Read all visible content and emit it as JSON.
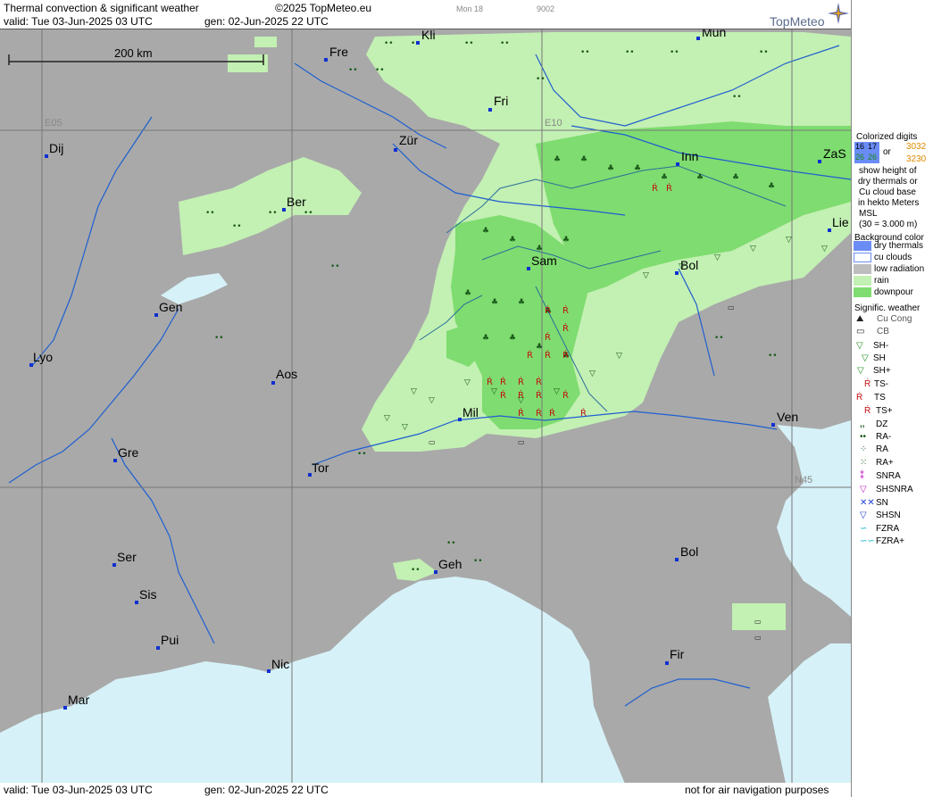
{
  "header": {
    "title": "Thermal convection & significant weather",
    "copyright": "©2025 TopMeteo.eu",
    "valid": "valid:  Tue  03-Jun-2025  03 UTC",
    "gen": "gen:  02-Jun-2025 22 UTC",
    "run": "Mon 18",
    "code": "9002",
    "brand": "TopMeteo"
  },
  "footer": {
    "valid": "valid:  Tue  03-Jun-2025  03 UTC",
    "gen": "gen:  02-Jun-2025 22 UTC",
    "disclaimer": "not for air navigation purposes"
  },
  "map": {
    "scale_label": "200 km",
    "grid_labels": [
      "E05",
      "E10",
      "N45"
    ],
    "cities": [
      "Kli",
      "Mün",
      "Fre",
      "Fri",
      "Dij",
      "Zür",
      "Inn",
      "ZaS",
      "Ber",
      "Lie",
      "Sam",
      "Bol",
      "Gen",
      "Lyo",
      "Aos",
      "Mil",
      "Ven",
      "Gre",
      "Tor",
      "Geh",
      "Ser",
      "Bol",
      "Sis",
      "Pui",
      "Nic",
      "Fir",
      "Mar"
    ],
    "colors": {
      "land": "#a9a9a9",
      "sea": "#d6f2f8",
      "rain": "#c3f0b3",
      "downpour": "#7fdc70",
      "rivers": "#1e5fd0"
    }
  },
  "legend": {
    "colorized_title": [
      "Colorized digits",
      "or",
      "show height of",
      "dry thermals or",
      "Cu cloud base",
      "in hekto Meters",
      "MSL",
      "(30 = 3.000 m)"
    ],
    "sample_cells": [
      "16",
      "17",
      "26",
      "26"
    ],
    "sample_digits": [
      "30",
      "32",
      "32",
      "30"
    ],
    "bg_title": "Background color",
    "bg_items": [
      {
        "label": "dry thermals",
        "color": "#6b8cf5"
      },
      {
        "label": "cu clouds",
        "color": "#ffffff"
      },
      {
        "label": "low radiation",
        "color": "#bdbdbd"
      },
      {
        "label": "rain",
        "color": "#c3f0b3"
      },
      {
        "label": "downpour",
        "color": "#7fdc70"
      }
    ],
    "wx_title": "Signific. weather",
    "wx_items": [
      "Cu Cong",
      "CB",
      "SH-",
      "SH",
      "SH+",
      "TS-",
      "TS",
      "TS+",
      "DZ",
      "RA-",
      "RA",
      "RA+",
      "SNRA",
      "SHSNRA",
      "SN",
      "SHSN",
      "FZRA",
      "FZRA+"
    ]
  }
}
